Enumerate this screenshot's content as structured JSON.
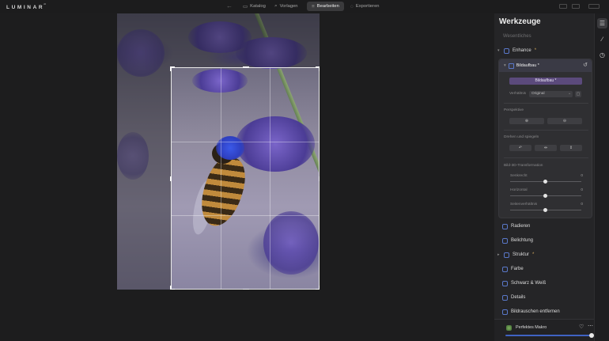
{
  "app": {
    "logo": "LUMINAR",
    "logo_version": "AI"
  },
  "topnav": {
    "back": "←",
    "items": [
      {
        "label": "Katalog",
        "icon": "folder-icon",
        "glyph": "▭"
      },
      {
        "label": "Vorlagen",
        "icon": "search-icon",
        "glyph": "⌕"
      },
      {
        "label": "Bearbeiten",
        "icon": "sliders-icon",
        "glyph": "≡",
        "active": true
      },
      {
        "label": "Exportieren",
        "icon": "export-icon",
        "glyph": "◌"
      }
    ]
  },
  "panel": {
    "title": "Werkzeuge",
    "section": "Wesentliches",
    "tools": [
      {
        "label": "Enhance",
        "mod": "*",
        "expanded": true
      },
      {
        "label": "Radieren",
        "mod": ""
      },
      {
        "label": "Belichtung",
        "mod": ""
      },
      {
        "label": "Struktur",
        "mod": "*"
      },
      {
        "label": "Farbe",
        "mod": ""
      },
      {
        "label": "Schwarz & Weiß",
        "mod": ""
      },
      {
        "label": "Details",
        "mod": ""
      },
      {
        "label": "Bildrauschen entfernen",
        "mod": ""
      }
    ],
    "crop": {
      "title": "Bildaufbau *",
      "reset_glyph": "↺",
      "button": "Bildaufbau *",
      "ratio_label": "Verhältnis",
      "ratio_value": "Original",
      "perspective_label": "Perspektive",
      "rotate_label": "Drehen und spiegeln",
      "transform_label": "Bild-3D-Transformation",
      "sliders": [
        {
          "label": "Senkrecht",
          "value": "0"
        },
        {
          "label": "Horizontal",
          "value": "0"
        },
        {
          "label": "Seitenverhältnis",
          "value": "0"
        }
      ]
    },
    "preset": {
      "name": "Perfektes Makro",
      "amount": 100
    }
  },
  "colors": {
    "accent": "#3f63c3",
    "mod": "#d6aa5e",
    "pill": "#5b4a7c"
  }
}
